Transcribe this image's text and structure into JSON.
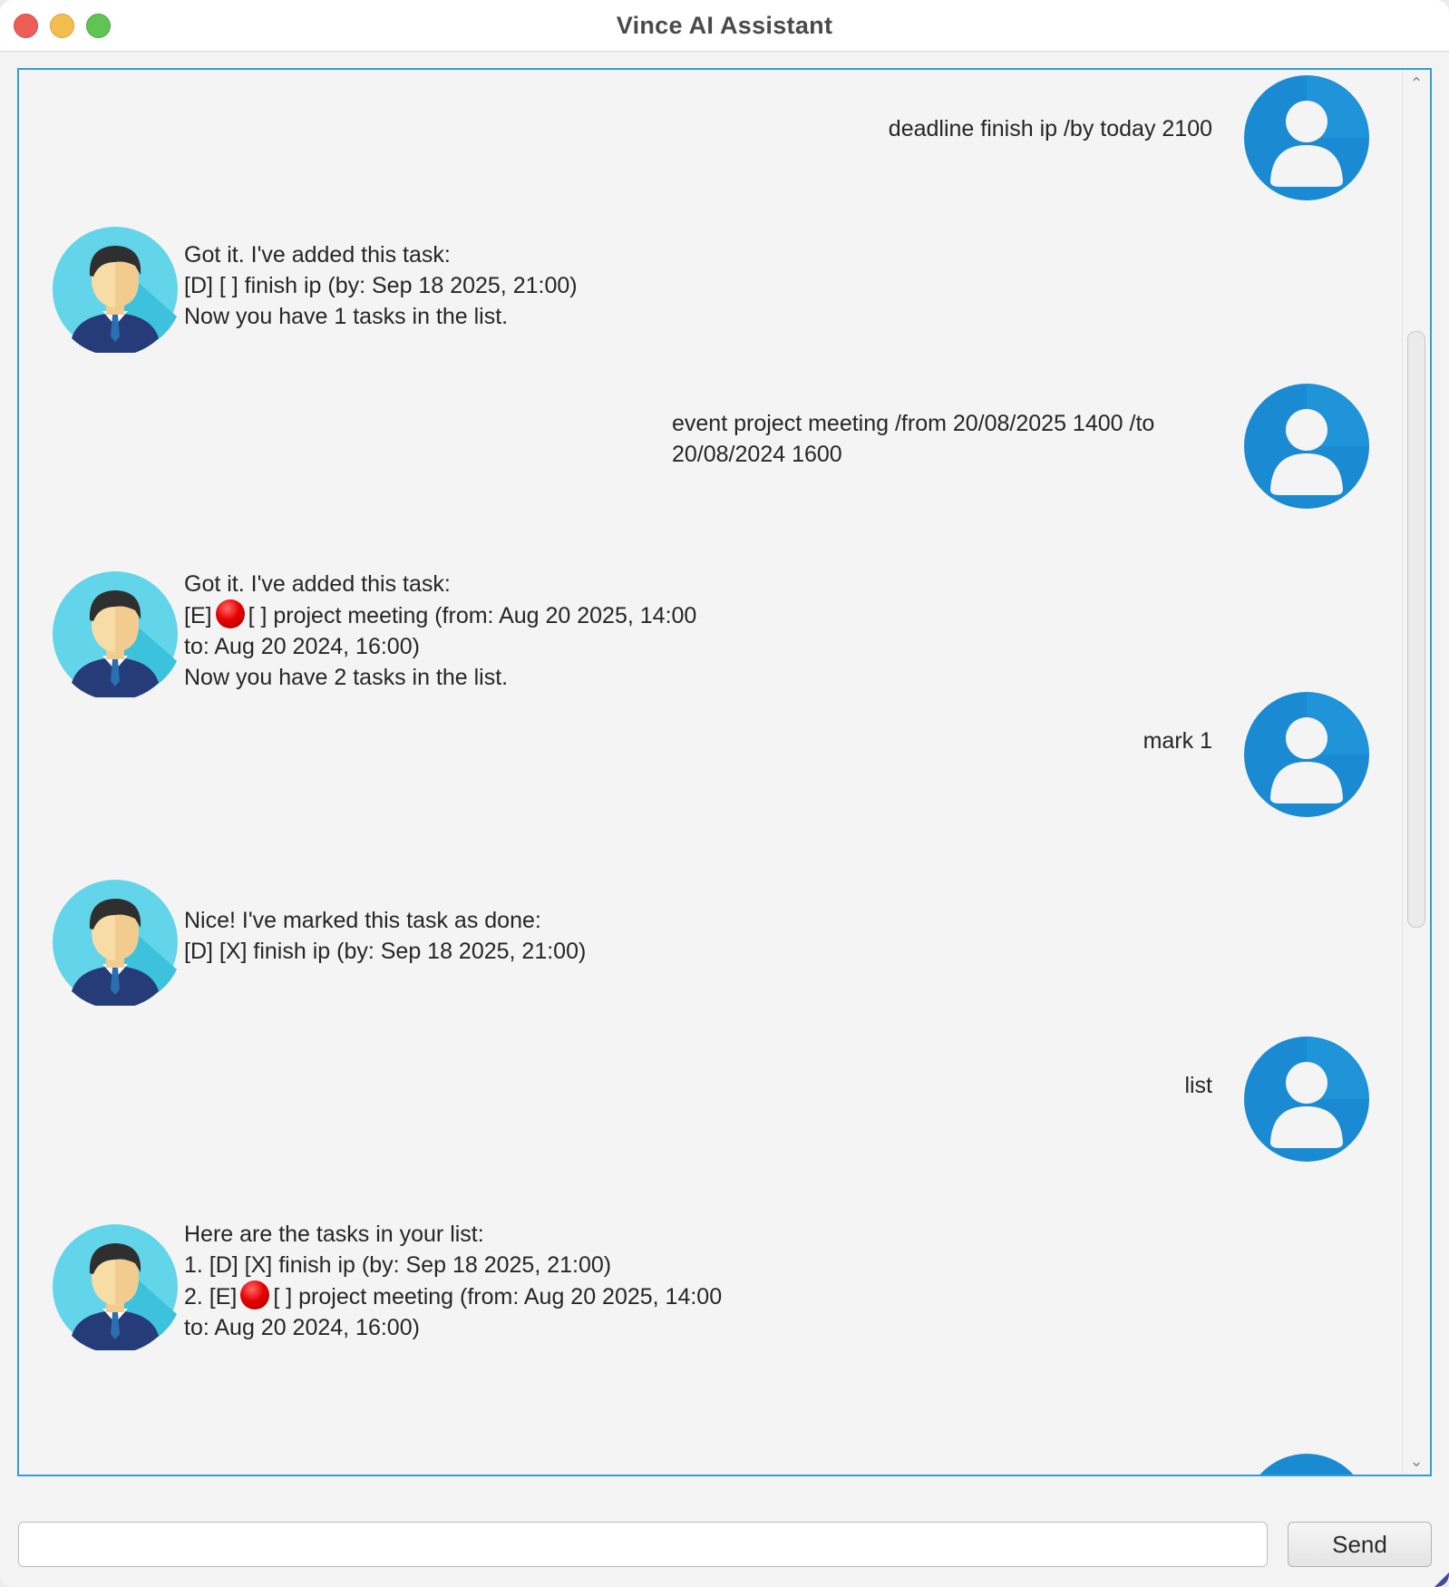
{
  "window": {
    "title": "Vince AI Assistant"
  },
  "messages": [
    {
      "sender": "user",
      "lines": [
        "deadline finish ip /by today 2100"
      ]
    },
    {
      "sender": "bot",
      "lines": [
        "Got it. I've added this task:",
        "[D] [ ] finish ip (by: Sep 18 2025, 21:00)",
        "Now you have 1 tasks in the list."
      ]
    },
    {
      "sender": "user",
      "lines": [
        "event project meeting /from 20/08/2025 1400 /to",
        "20/08/2024 1600"
      ]
    },
    {
      "sender": "bot",
      "lines": [
        "Got it. I've added this task:",
        "[E]",
        "[ ] project meeting (from: Aug 20 2025, 14:00",
        "to: Aug 20 2024, 16:00)",
        "Now you have 2 tasks in the list."
      ]
    },
    {
      "sender": "user",
      "lines": [
        "mark 1"
      ]
    },
    {
      "sender": "bot",
      "lines": [
        "Nice! I've marked this task as done:",
        "[D] [X] finish ip (by: Sep 18 2025, 21:00)"
      ]
    },
    {
      "sender": "user",
      "lines": [
        "list"
      ]
    },
    {
      "sender": "bot",
      "lines": [
        "Here are the tasks in your list:",
        "1. [D] [X] finish ip (by: Sep 18 2025, 21:00)",
        "2. [E]",
        "[ ] project meeting (from: Aug 20 2025, 14:00",
        "to: Aug 20 2024, 16:00)"
      ]
    }
  ],
  "input": {
    "value": "",
    "placeholder": ""
  },
  "send_button": {
    "label": "Send"
  },
  "icons": {
    "user_avatar": "user-avatar-icon",
    "bot_avatar": "bot-avatar-icon",
    "overlap_event_marker": "red-circle-icon"
  },
  "colors": {
    "chat_border": "#2e9fd6",
    "user_avatar": "#1e8fd6",
    "bot_avatar": "#5fd1e8",
    "marker": "#e60000"
  }
}
